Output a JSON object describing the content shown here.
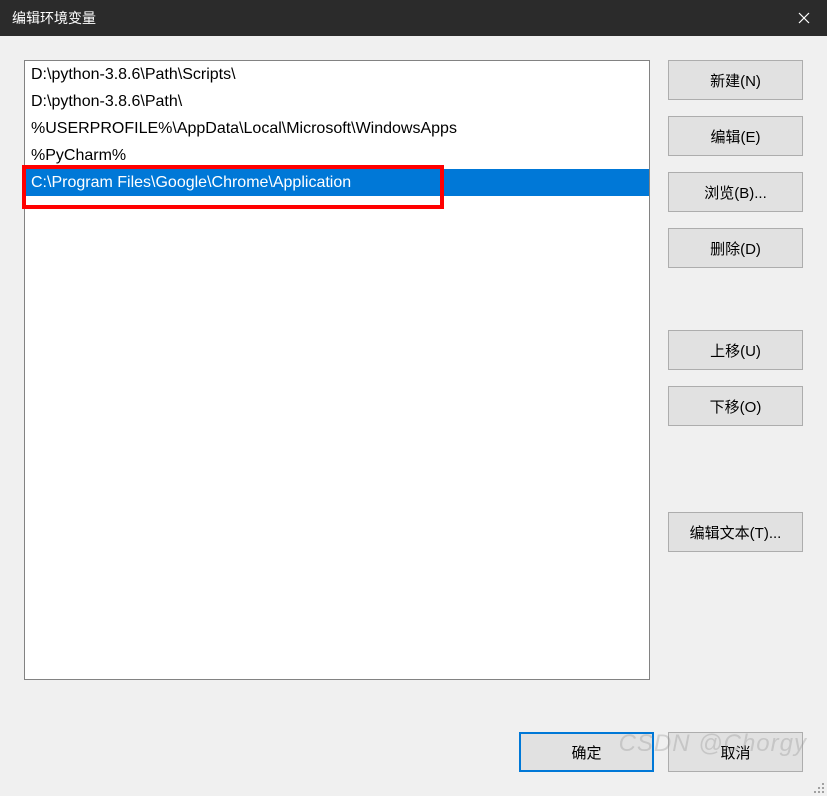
{
  "titlebar": {
    "title": "编辑环境变量"
  },
  "list": {
    "items": [
      {
        "text": "D:\\python-3.8.6\\Path\\Scripts\\",
        "selected": false
      },
      {
        "text": "D:\\python-3.8.6\\Path\\",
        "selected": false
      },
      {
        "text": "%USERPROFILE%\\AppData\\Local\\Microsoft\\WindowsApps",
        "selected": false
      },
      {
        "text": "%PyCharm%",
        "selected": false
      },
      {
        "text": "C:\\Program Files\\Google\\Chrome\\Application",
        "selected": true
      }
    ]
  },
  "buttons": {
    "new": "新建(N)",
    "edit": "编辑(E)",
    "browse": "浏览(B)...",
    "delete": "删除(D)",
    "moveup": "上移(U)",
    "movedown": "下移(O)",
    "edittext": "编辑文本(T)..."
  },
  "footer": {
    "ok": "确定",
    "cancel": "取消"
  },
  "watermark": "CSDN @Chorgy"
}
